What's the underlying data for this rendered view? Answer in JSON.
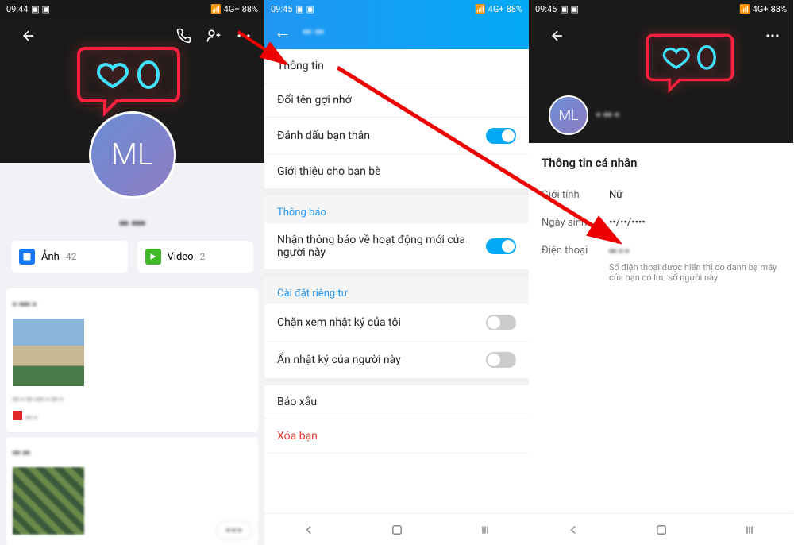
{
  "status": {
    "t1": "09:44",
    "t2": "09:45",
    "t3": "09:46",
    "battery": "88%",
    "net": "4G+"
  },
  "avatar": "ML",
  "screen1": {
    "username": "▪▪  ▪▪▪",
    "btn_photo": "Ảnh",
    "btn_photo_count": "42",
    "btn_video": "Video",
    "btn_video_count": "2"
  },
  "screen2": {
    "title": "▪▪ ▪▪",
    "items": [
      {
        "label": "Thông tin"
      },
      {
        "label": "Đổi tên gợi nhớ"
      },
      {
        "label": "Đánh dấu bạn thân",
        "toggle": true,
        "on": true
      },
      {
        "label": "Giới thiệu cho bạn bè"
      }
    ],
    "sect_noti": "Thông báo",
    "noti_label": "Nhận thông báo về hoạt động mới của người này",
    "sect_priv": "Cài đặt riêng tư",
    "priv1": "Chặn xem nhật ký của tôi",
    "priv2": "Ẩn nhật ký của người này",
    "report": "Báo xấu",
    "delete": "Xóa bạn"
  },
  "screen3": {
    "heading": "Thông tin cá nhân",
    "gender_k": "Giới tính",
    "gender_v": "Nữ",
    "dob_k": "Ngày sinh",
    "dob_v": "••/••/••••",
    "phone_k": "Điện thoại",
    "phone_v": "▪▪  ▪  ▪",
    "phone_note": "Số điện thoại được hiển thị do danh bạ máy của bạn có lưu số người này"
  }
}
